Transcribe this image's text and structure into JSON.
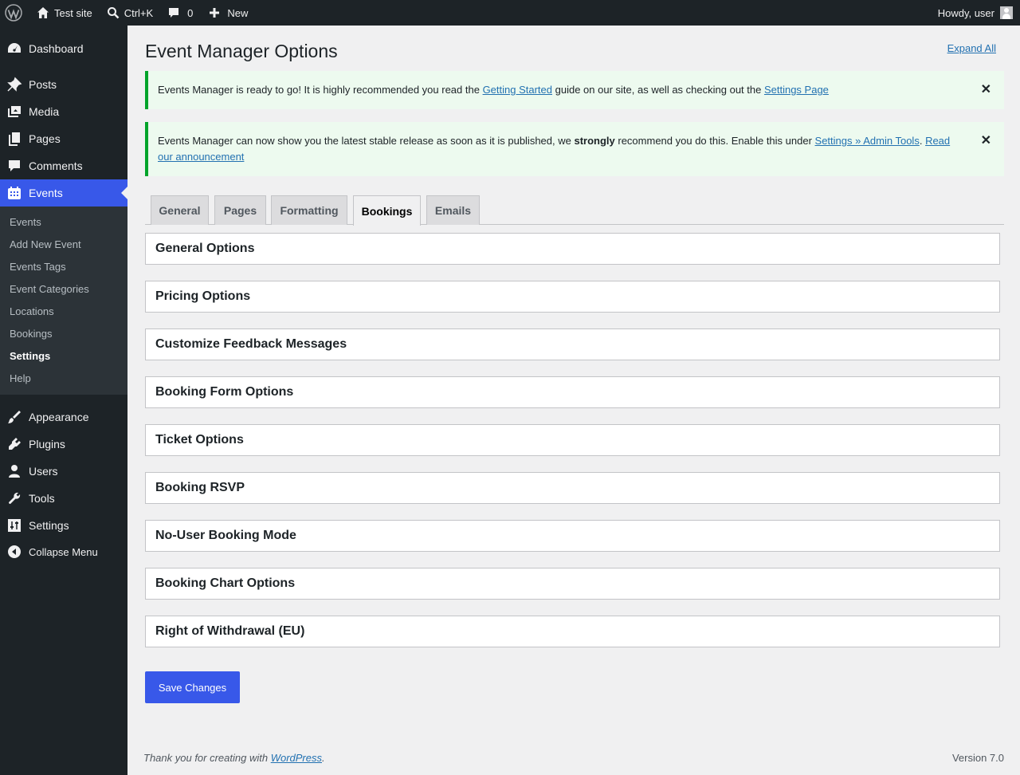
{
  "admin_bar": {
    "site_name": "Test site",
    "search_shortcut": "Ctrl+K",
    "comments_count": "0",
    "new_label": "New",
    "howdy": "Howdy, user"
  },
  "sidebar": {
    "items": [
      {
        "label": "Dashboard",
        "icon": "dashboard-icon"
      },
      {
        "label": "Posts",
        "icon": "pin-icon"
      },
      {
        "label": "Media",
        "icon": "media-icon"
      },
      {
        "label": "Pages",
        "icon": "pages-icon"
      },
      {
        "label": "Comments",
        "icon": "comment-icon"
      },
      {
        "label": "Events",
        "icon": "calendar-icon"
      },
      {
        "label": "Appearance",
        "icon": "brush-icon"
      },
      {
        "label": "Plugins",
        "icon": "plug-icon"
      },
      {
        "label": "Users",
        "icon": "user-icon"
      },
      {
        "label": "Tools",
        "icon": "wrench-icon"
      },
      {
        "label": "Settings",
        "icon": "sliders-icon"
      }
    ],
    "submenu": [
      "Events",
      "Add New Event",
      "Events Tags",
      "Event Categories",
      "Locations",
      "Bookings",
      "Settings",
      "Help"
    ],
    "current_submenu": "Settings",
    "collapse_label": "Collapse Menu"
  },
  "page": {
    "title": "Event Manager Options",
    "expand_all": "Expand All"
  },
  "notices": {
    "first": {
      "text_before": "Events Manager is ready to go! It is highly recommended you read the ",
      "link1": "Getting Started",
      "text_middle": " guide on our site, as well as checking out the ",
      "link2": "Settings Page"
    },
    "second": {
      "text_before": "Events Manager can now show you the latest stable release as soon as it is published, we ",
      "strong": "strongly",
      "text_middle": " recommend you do this. Enable this under ",
      "link1": "Settings » Admin Tools",
      "text_after": ". ",
      "link2": "Read our announcement"
    },
    "dismiss_glyph": "✕"
  },
  "tabs": [
    "General",
    "Pages",
    "Formatting",
    "Bookings",
    "Emails"
  ],
  "active_tab": "Bookings",
  "sections": [
    "General Options",
    "Pricing Options",
    "Customize Feedback Messages",
    "Booking Form Options",
    "Ticket Options",
    "Booking RSVP",
    "No-User Booking Mode",
    "Booking Chart Options",
    "Right of Withdrawal (EU)"
  ],
  "save_button": "Save Changes",
  "footer": {
    "thanks_before": "Thank you for creating with ",
    "wordpress_link": "WordPress",
    "thanks_after": ".",
    "version": "Version 7.0"
  },
  "colors": {
    "admin_bar": "#1d2327",
    "accent": "#3858e9",
    "notice_border": "#00a32a",
    "notice_bg": "#edfaef"
  }
}
